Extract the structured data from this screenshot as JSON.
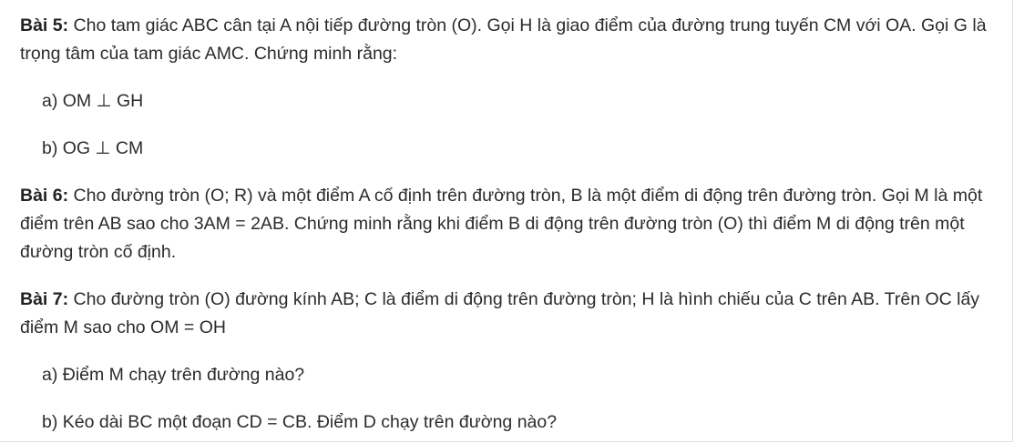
{
  "problems": [
    {
      "label": "Bài 5:",
      "text": " Cho tam giác ABC cân tại A nội tiếp đường tròn (O). Gọi H là giao điểm của đường trung tuyến CM với OA. Gọi G là trọng tâm của tam giác AMC. Chứng minh rằng:",
      "parts": [
        "a) OM ⊥ GH",
        "b) OG ⊥ CM"
      ]
    },
    {
      "label": "Bài 6:",
      "text": " Cho đường tròn (O; R) và một điểm A cố định trên đường tròn, B là một điểm di động trên đường tròn. Gọi M là một điểm trên AB sao cho 3AM = 2AB. Chứng minh rằng khi điểm B di động trên đường tròn (O) thì điểm M di động trên một đường tròn cố định.",
      "parts": []
    },
    {
      "label": "Bài 7:",
      "text": " Cho đường tròn (O) đường kính AB; C là điểm di động trên đường tròn; H là hình chiếu của C trên AB. Trên OC lấy điểm M sao cho OM = OH",
      "parts": [
        "a) Điểm M chạy trên đường nào?",
        "b) Kéo dài BC một đoạn CD = CB. Điểm D chạy trên đường nào?"
      ]
    }
  ]
}
